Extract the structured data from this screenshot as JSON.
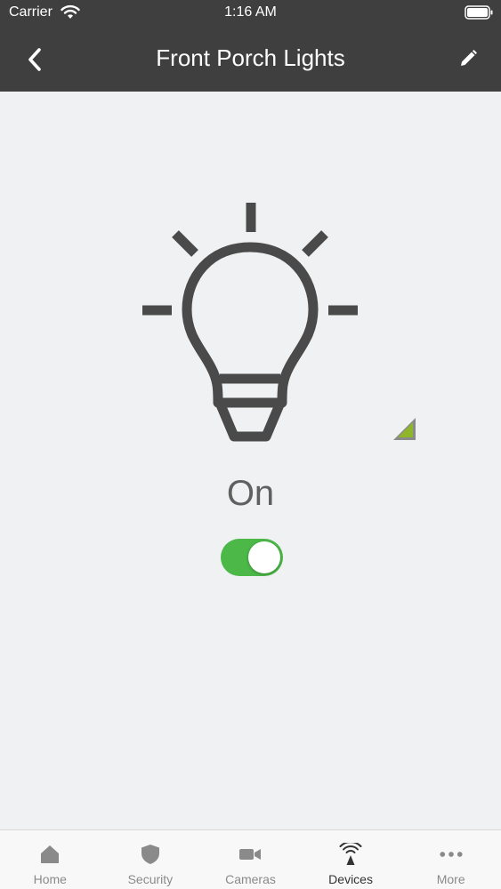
{
  "status_bar": {
    "carrier": "Carrier",
    "time": "1:16 AM"
  },
  "nav": {
    "title": "Front Porch Lights",
    "back_icon": "chevron-left-icon",
    "edit_icon": "pencil-icon"
  },
  "device": {
    "icon": "light-bulb-icon",
    "state_label": "On",
    "toggle_on": true,
    "toggle_color": "#4cb848"
  },
  "tabs": [
    {
      "label": "Home",
      "icon": "home-icon",
      "active": false
    },
    {
      "label": "Security",
      "icon": "shield-icon",
      "active": false
    },
    {
      "label": "Cameras",
      "icon": "video-camera-icon",
      "active": false
    },
    {
      "label": "Devices",
      "icon": "devices-icon",
      "active": true
    },
    {
      "label": "More",
      "icon": "more-dots-icon",
      "active": false
    }
  ],
  "colors": {
    "header_bg": "#3f3f3f",
    "accent_green": "#4cb848",
    "signal_green": "#8fb52a"
  }
}
